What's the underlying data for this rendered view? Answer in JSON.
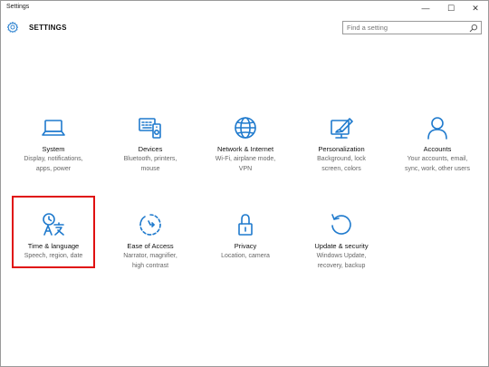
{
  "window": {
    "title": "Settings",
    "minimize_glyph": "—",
    "maximize_glyph": "☐",
    "close_glyph": "✕"
  },
  "header": {
    "icon": "gear-icon",
    "title": "SETTINGS",
    "search_placeholder": "Find a setting",
    "search_icon": "search-icon"
  },
  "accent_color": "#1f7acd",
  "highlight_color": "#e01010",
  "tiles": [
    {
      "label": "System",
      "desc": "Display, notifications,\napps, power",
      "icon": "laptop-icon"
    },
    {
      "label": "Devices",
      "desc": "Bluetooth, printers,\nmouse",
      "icon": "devices-icon"
    },
    {
      "label": "Network & Internet",
      "desc": "Wi-Fi, airplane mode,\nVPN",
      "icon": "globe-icon"
    },
    {
      "label": "Personalization",
      "desc": "Background, lock\nscreen, colors",
      "icon": "paint-icon"
    },
    {
      "label": "Accounts",
      "desc": "Your accounts, email,\nsync, work, other users",
      "icon": "person-icon"
    },
    {
      "label": "Time & language",
      "desc": "Speech, region, date",
      "icon": "time-language-icon"
    },
    {
      "label": "Ease of Access",
      "desc": "Narrator, magnifier,\nhigh contrast",
      "icon": "ease-of-access-icon"
    },
    {
      "label": "Privacy",
      "desc": "Location, camera",
      "icon": "lock-icon"
    },
    {
      "label": "Update & security",
      "desc": "Windows Update,\nrecovery, backup",
      "icon": "update-icon"
    }
  ]
}
